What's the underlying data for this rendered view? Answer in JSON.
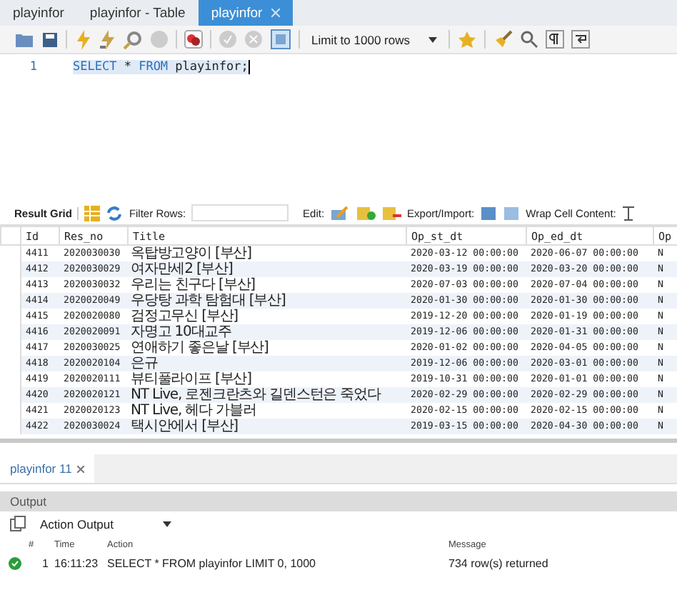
{
  "tabs": [
    {
      "label": "playinfor",
      "selected": false,
      "closable": false
    },
    {
      "label": "playinfor - Table",
      "selected": false,
      "closable": false
    },
    {
      "label": "playinfor",
      "selected": true,
      "closable": true
    }
  ],
  "toolbar": {
    "limit": "Limit to 1000 rows",
    "toggle_output": true
  },
  "editor": {
    "lines": [
      {
        "number": "1",
        "tokens": [
          {
            "text": "SELECT",
            "kind": "keyword"
          },
          {
            "text": " * ",
            "kind": "plain"
          },
          {
            "text": "FROM",
            "kind": "keyword"
          },
          {
            "text": " playinfor;",
            "kind": "plain"
          }
        ]
      }
    ]
  },
  "result_toolbar": {
    "result_grid": "Result Grid",
    "filter": "Filter Rows:",
    "edit": "Edit:",
    "export": "Export/Import:",
    "wrap": "Wrap Cell Content:"
  },
  "table": {
    "columns": [
      "Id",
      "Res_no",
      "Title",
      "Op_st_dt",
      "Op_ed_dt",
      "Op"
    ],
    "rows": [
      [
        "4411",
        "2020030030",
        "옥탑방고양이 [부산]",
        "2020-03-12 00:00:00",
        "2020-06-07 00:00:00",
        "N"
      ],
      [
        "4412",
        "2020030029",
        "여자만세2 [부산]",
        "2020-03-19 00:00:00",
        "2020-03-20 00:00:00",
        "N"
      ],
      [
        "4413",
        "2020030032",
        "우리는 친구다 [부산]",
        "2020-07-03 00:00:00",
        "2020-07-04 00:00:00",
        "N"
      ],
      [
        "4414",
        "2020020049",
        "우당탕 과학 탐험대 [부산]",
        "2020-01-30 00:00:00",
        "2020-01-30 00:00:00",
        "N"
      ],
      [
        "4415",
        "2020020080",
        "검정고무신 [부산]",
        "2019-12-20 00:00:00",
        "2020-01-19 00:00:00",
        "N"
      ],
      [
        "4416",
        "2020020091",
        "자명고 10대교주",
        "2019-12-06 00:00:00",
        "2020-01-31 00:00:00",
        "N"
      ],
      [
        "4417",
        "2020030025",
        "연애하기 좋은날 [부산]",
        "2020-01-02 00:00:00",
        "2020-04-05 00:00:00",
        "N"
      ],
      [
        "4418",
        "2020020104",
        "은규",
        "2019-12-06 00:00:00",
        "2020-03-01 00:00:00",
        "N"
      ],
      [
        "4419",
        "2020020111",
        "뷰티풀라이프 [부산]",
        "2019-10-31 00:00:00",
        "2020-01-01 00:00:00",
        "N"
      ],
      [
        "4420",
        "2020020121",
        "NT Live, 로젠크란츠와 길덴스턴은 죽었다",
        "2020-02-29 00:00:00",
        "2020-02-29 00:00:00",
        "N"
      ],
      [
        "4421",
        "2020020123",
        "NT Live, 헤다 가블러",
        "2020-02-15 00:00:00",
        "2020-02-15 00:00:00",
        "N"
      ],
      [
        "4422",
        "2020030024",
        "택시안에서 [부산]",
        "2019-03-15 00:00:00",
        "2020-04-30 00:00:00",
        "N"
      ]
    ]
  },
  "result_tabs": [
    {
      "label": "playinfor 11",
      "selected": true
    }
  ],
  "output": {
    "title": "Output",
    "mode": "Action Output",
    "columns": [
      "#",
      "Time",
      "Action",
      "Message"
    ],
    "rows": [
      {
        "success": true,
        "number": "1",
        "time": "16:11:23",
        "action": "SELECT * FROM playinfor LIMIT 0, 1000",
        "message": "734 row(s) returned"
      }
    ]
  }
}
